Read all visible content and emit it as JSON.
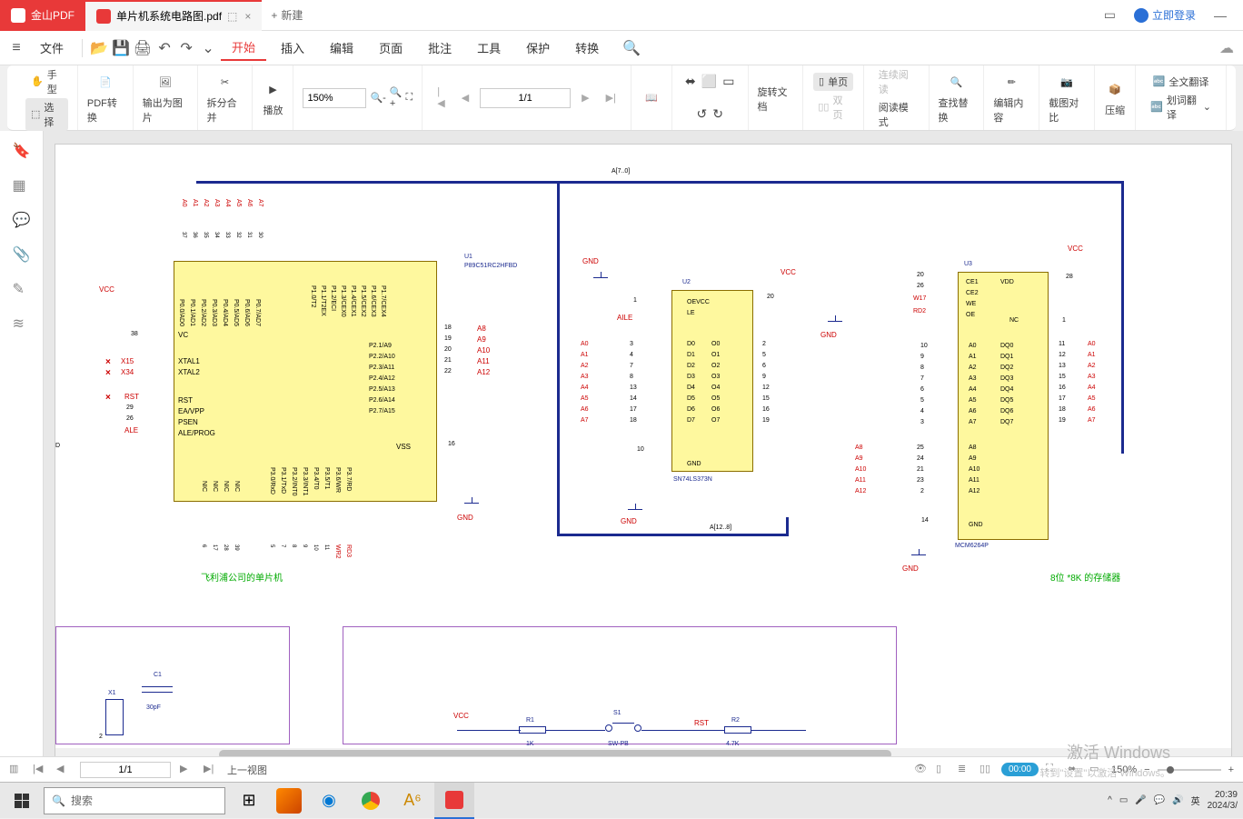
{
  "titlebar": {
    "app_name": "金山PDF",
    "doc_tab": "单片机系统电路图.pdf",
    "new_tab": "新建",
    "login": "立即登录"
  },
  "menubar": {
    "file": "文件",
    "items": [
      "开始",
      "插入",
      "编辑",
      "页面",
      "批注",
      "工具",
      "保护",
      "转换"
    ]
  },
  "ribbon": {
    "hand": "手型",
    "select": "选择",
    "convert": "PDF转换",
    "export_img": "输出为图片",
    "split_merge": "拆分合并",
    "play": "播放",
    "zoom": "150%",
    "rotate": "旋转文档",
    "single_page": "单页",
    "dual_page": "双页",
    "continuous": "连续阅读",
    "read_mode": "阅读模式",
    "find_replace": "查找替换",
    "edit_content": "编辑内容",
    "compare": "截图对比",
    "compress": "压缩",
    "translate": "全文翻译",
    "word_translate": "划词翻译",
    "page_num": "1/1"
  },
  "diagram": {
    "u1_label": "U1",
    "u1_part": "P89C51RC2HFBD",
    "u2_label": "U2",
    "u2_part": "SN74LS373N",
    "u3_label": "U3",
    "u3_part": "MCM6264P",
    "vcc": "VCC",
    "gnd": "GND",
    "bus_a70": "A[7..0]",
    "bus_a128": "A[12..8]",
    "green1": "飞利浦公司的单片机",
    "green2": "8位 *8K 的存储器",
    "x1": "X1",
    "c1": "C1",
    "c1_val": "30pF",
    "s1": "S1",
    "sw_pb": "SW-PB",
    "r1": "R1",
    "r1_val": "1K",
    "r2": "R2",
    "r2_val": "4.7K",
    "rst": "RST",
    "x15": "X15",
    "x34": "X34",
    "rst_pin": "RST",
    "ale": "ALE",
    "xtal1": "XTAL1",
    "xtal2": "XTAL2",
    "rst_l": "RST",
    "ea_vpp": "EA/VPP",
    "psen": "PSEN",
    "ale_prog": "ALE/PROG",
    "vss": "VSS",
    "vc": "VC",
    "d": "D",
    "aile": "AILE",
    "oe_vcc": "OEVCC",
    "le": "LE",
    "ce1": "CE1",
    "ce2": "CE2",
    "we": "WE",
    "oe": "OE",
    "vdd": "VDD",
    "nc": "NC",
    "w17": "W17",
    "rd2": "RD2",
    "wr2": "WR2",
    "rd3": "RD3",
    "nic": "NIC"
  },
  "statusbar": {
    "page": "1/1",
    "prev_view": "上一视图",
    "zoom": "150%",
    "rec_time": "00:00"
  },
  "taskbar": {
    "search_placeholder": "搜索",
    "ime": "英",
    "time": "20:39",
    "date": "2024/3/"
  },
  "watermark": {
    "title": "激活 Windows",
    "sub": "转到\"设置\"以激活 Windows。"
  }
}
